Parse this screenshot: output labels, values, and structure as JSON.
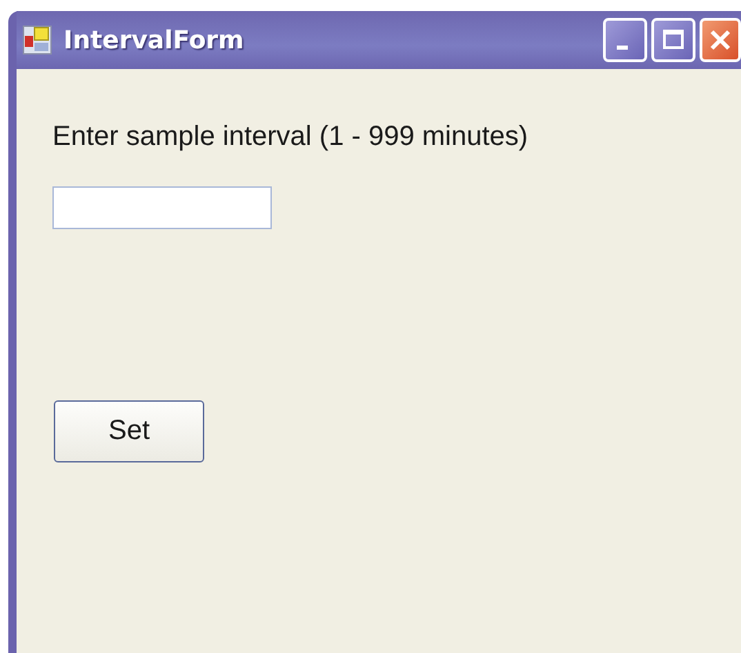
{
  "window": {
    "title": "IntervalForm"
  },
  "prompt": "Enter sample interval (1 - 999 minutes)",
  "buttons": [
    {
      "label": "Set"
    }
  ]
}
